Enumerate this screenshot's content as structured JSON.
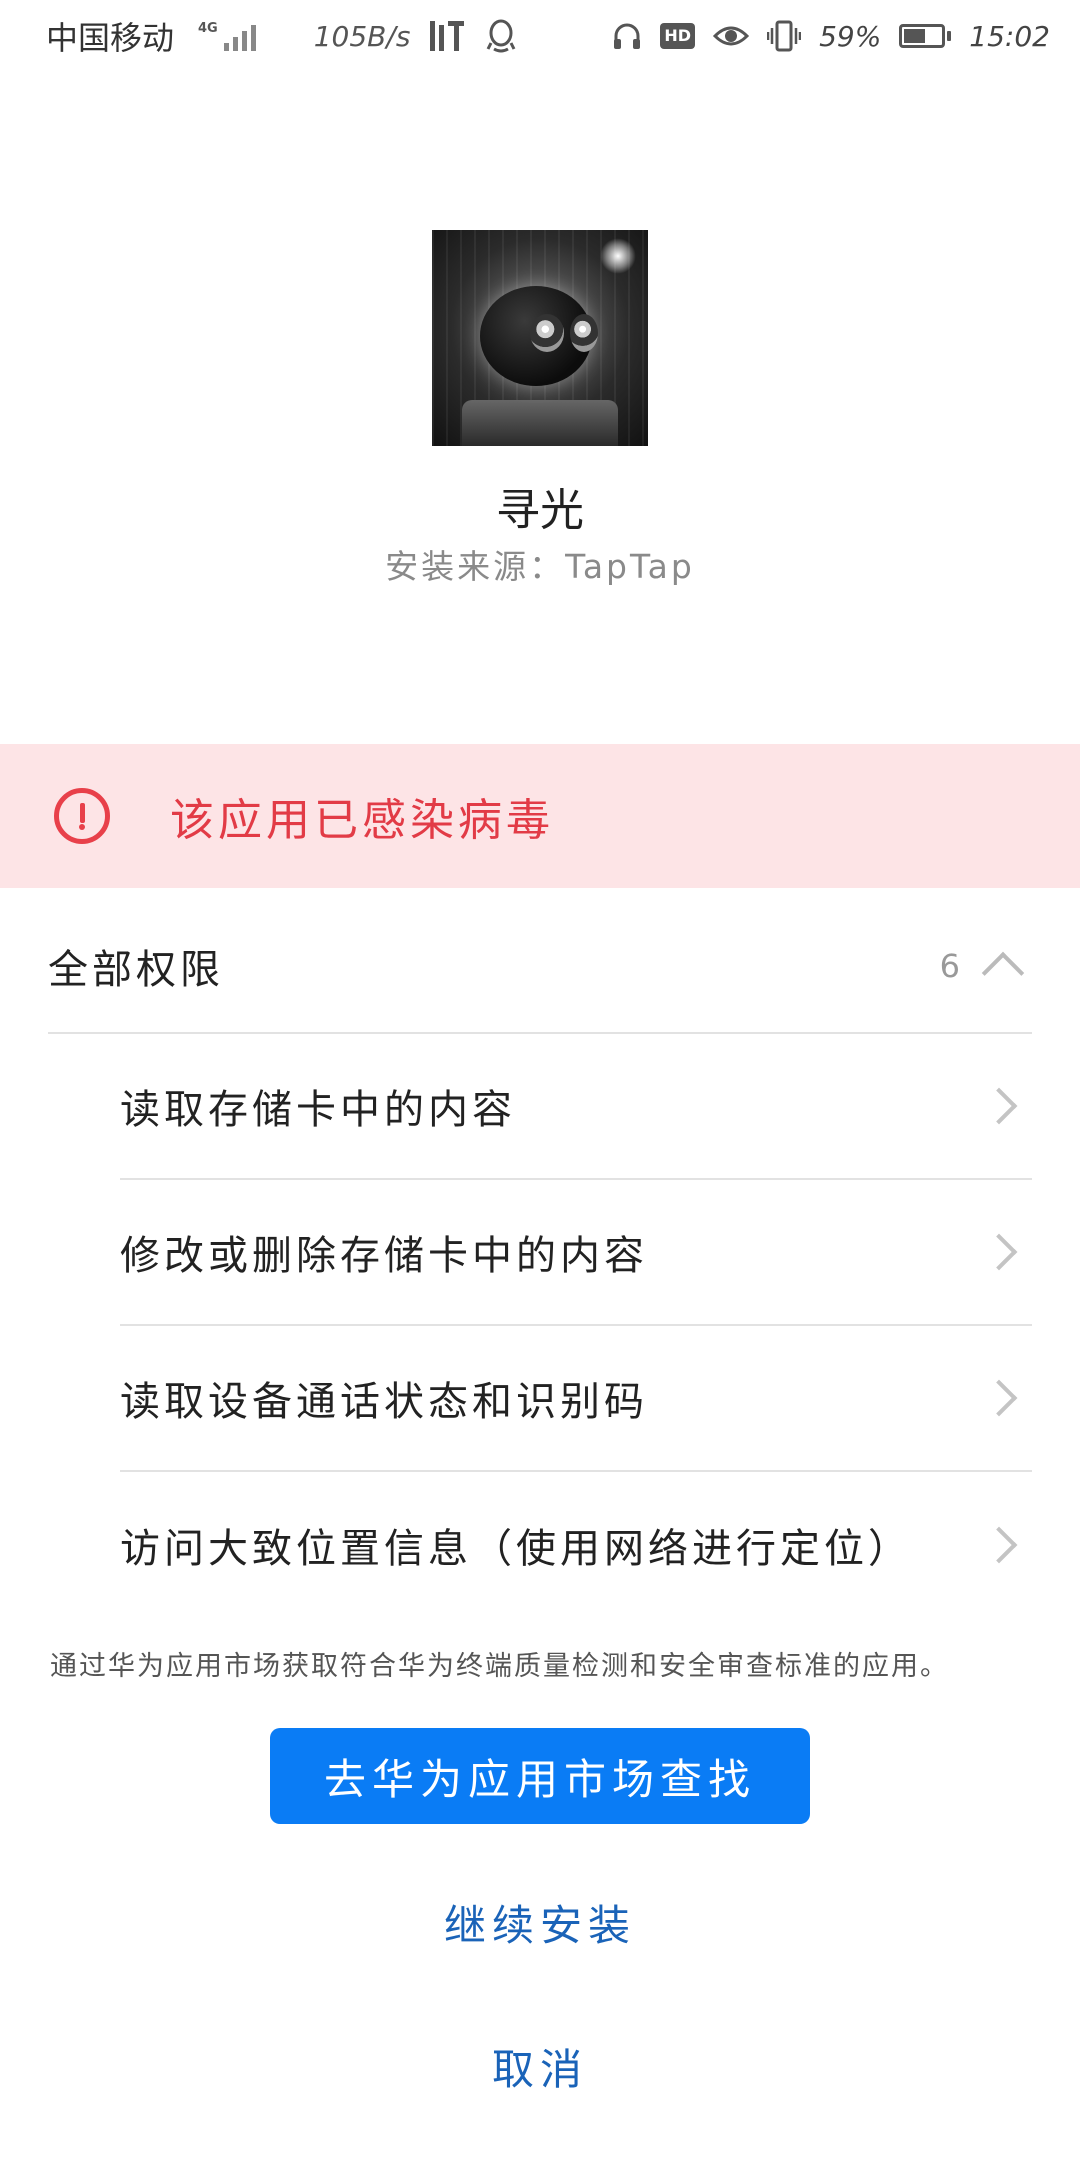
{
  "status_bar": {
    "carrier": "中国移动",
    "network_type": "4G",
    "net_speed": "105B/s",
    "battery_percent": "59%",
    "battery_level": 0.59,
    "time": "15:02",
    "icons": [
      "signal-icon",
      "ting-app-icon",
      "qq-icon",
      "headphones-icon",
      "hd-icon",
      "eye-comfort-icon",
      "vibrate-icon",
      "battery-icon"
    ],
    "hd_label": "HD"
  },
  "app": {
    "name": "寻光",
    "source": "安装来源：TapTap"
  },
  "warning": {
    "text": "该应用已感染病毒",
    "color": "#e23b46",
    "background": "#fde4e6"
  },
  "permissions": {
    "title": "全部权限",
    "count": "6",
    "items": [
      {
        "label": "读取存储卡中的内容"
      },
      {
        "label": "修改或删除存储卡中的内容"
      },
      {
        "label": "读取设备通话状态和识别码"
      },
      {
        "label": "访问大致位置信息（使用网络进行定位）"
      }
    ]
  },
  "note": "通过华为应用市场获取符合华为终端质量检测和安全审查标准的应用。",
  "actions": {
    "primary": "去华为应用市场查找",
    "continue": "继续安装",
    "cancel": "取消",
    "primary_color": "#0a7cf5",
    "link_color": "#1a63b8"
  }
}
